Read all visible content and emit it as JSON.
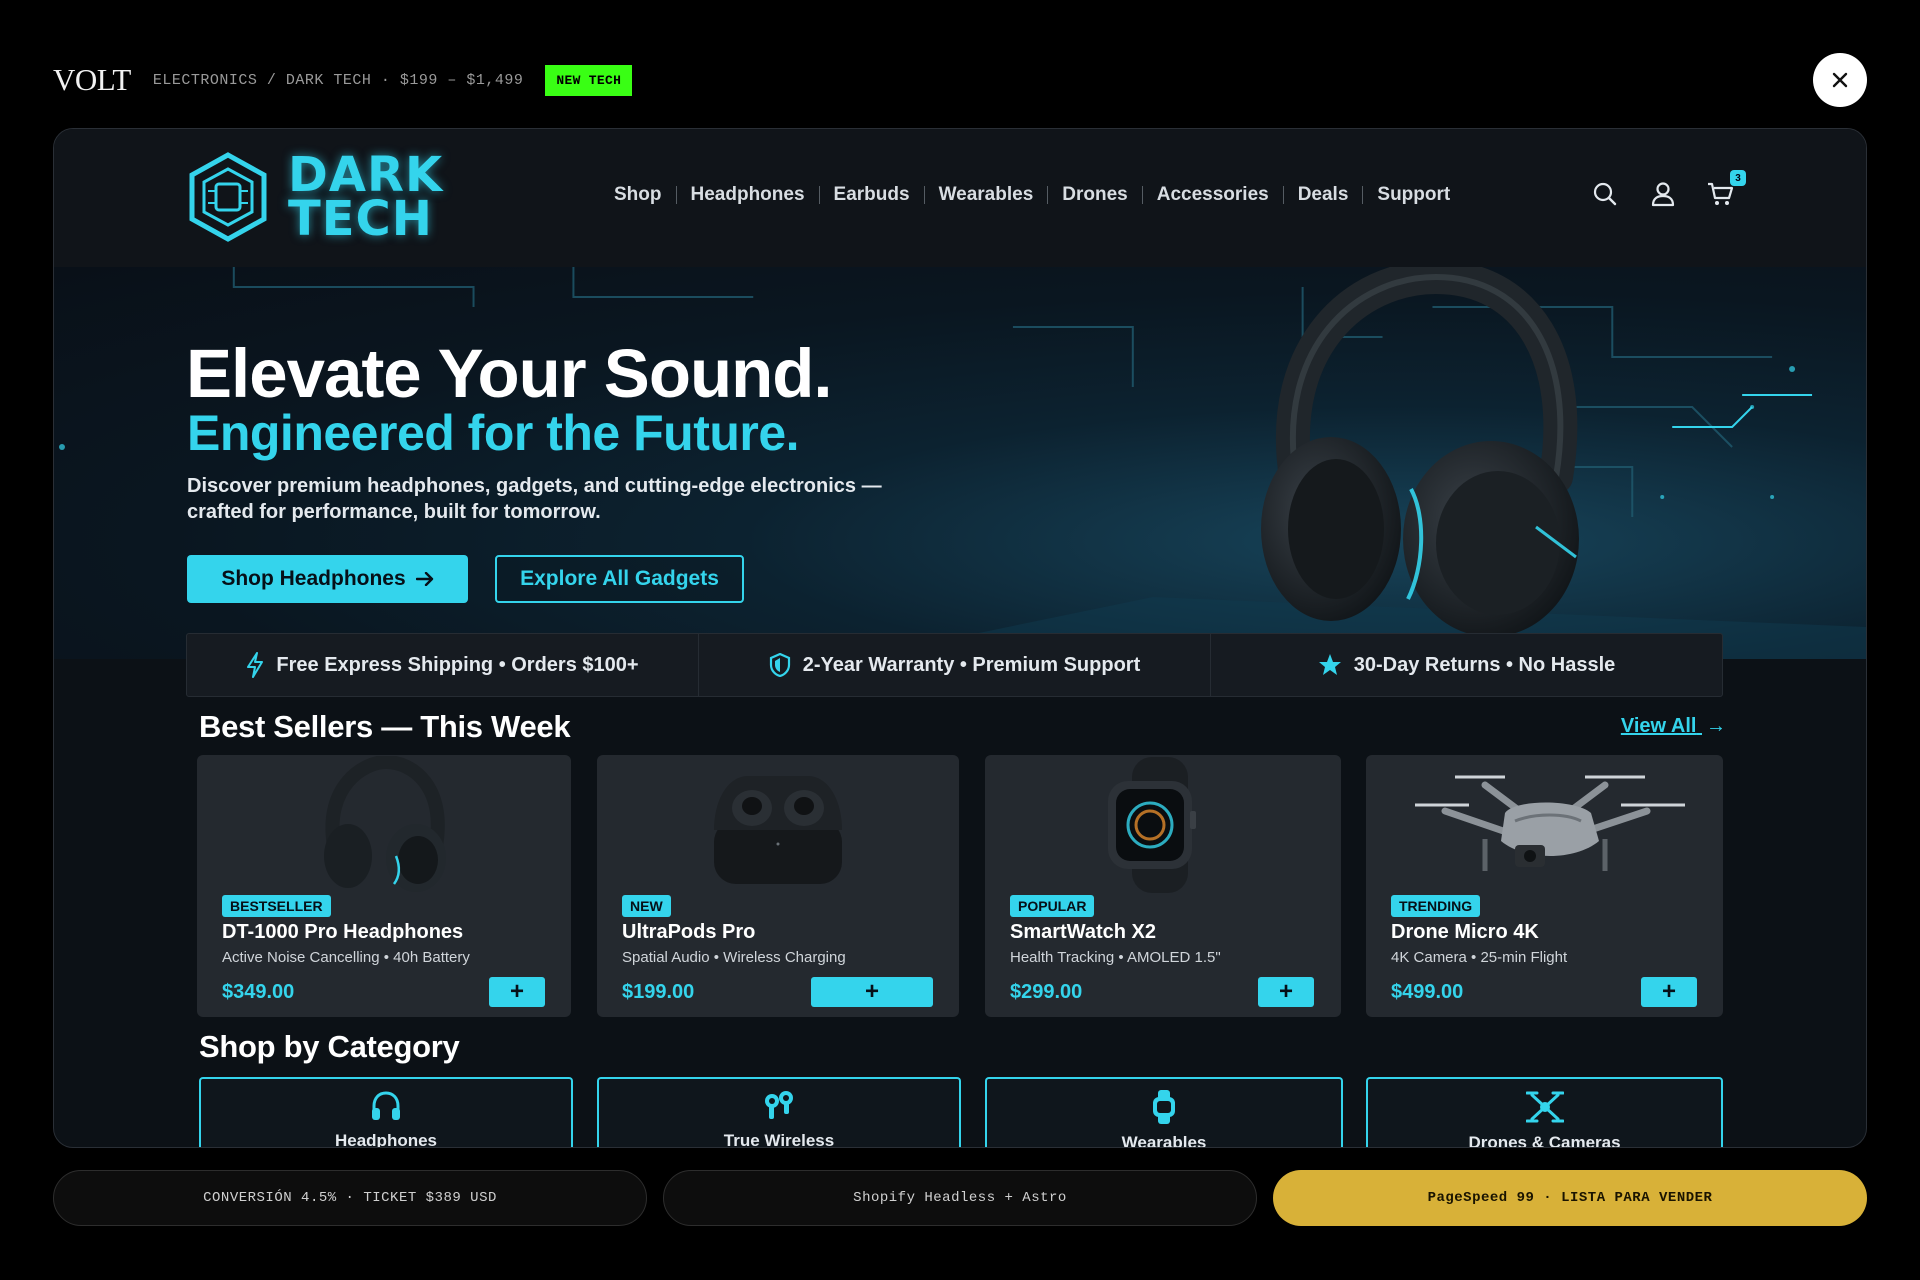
{
  "top": {
    "brand": "VOLT",
    "breadcrumb": "ELECTRONICS / DARK TECH · $199 – $1,499",
    "tag": "NEW TECH"
  },
  "site": {
    "logo_line1": "DARK",
    "logo_line2": "TECH",
    "nav": [
      "Shop",
      "Headphones",
      "Earbuds",
      "Wearables",
      "Drones",
      "Accessories",
      "Deals",
      "Support"
    ],
    "cart_count": "3"
  },
  "hero": {
    "title": "Elevate Your Sound.",
    "subtitle": "Engineered for the Future.",
    "description": "Discover premium headphones, gadgets, and cutting-edge electronics — crafted for performance, built for tomorrow.",
    "primary_cta": "Shop Headphones",
    "secondary_cta": "Explore All Gadgets"
  },
  "benefits": [
    {
      "icon": "lightning-icon",
      "text": "Free Express Shipping • Orders $100+"
    },
    {
      "icon": "shield-icon",
      "text": "2-Year Warranty • Premium Support"
    },
    {
      "icon": "star-icon",
      "text": "30-Day Returns • No Hassle"
    }
  ],
  "best_sellers": {
    "title": "Best Sellers — This Week",
    "view_all": "View All",
    "products": [
      {
        "badge": "BESTSELLER",
        "name": "DT-1000 Pro Headphones",
        "desc": "Active Noise Cancelling • 40h Battery",
        "price": "$349.00",
        "add": "+"
      },
      {
        "badge": "NEW",
        "name": "UltraPods Pro",
        "desc": "Spatial Audio • Wireless Charging",
        "price": "$199.00",
        "add": "+"
      },
      {
        "badge": "POPULAR",
        "name": "SmartWatch X2",
        "desc": "Health Tracking • AMOLED 1.5\"",
        "price": "$299.00",
        "add": "+"
      },
      {
        "badge": "TRENDING",
        "name": "Drone Micro 4K",
        "desc": "4K Camera • 25-min Flight",
        "price": "$499.00",
        "add": "+"
      }
    ]
  },
  "categories": {
    "title": "Shop by Category",
    "items": [
      {
        "icon": "headphones-icon",
        "label": "Headphones"
      },
      {
        "icon": "earbuds-icon",
        "label": "True Wireless"
      },
      {
        "icon": "watch-icon",
        "label": "Wearables"
      },
      {
        "icon": "drone-icon",
        "label": "Drones & Cameras"
      }
    ]
  },
  "footer": {
    "stats": "CONVERSIÓN 4.5% · TICKET $389 USD",
    "stack": "Shopify Headless + Astro",
    "score": "PageSpeed 99 · LISTA PARA VENDER"
  },
  "colors": {
    "accent": "#34d4ec",
    "tag_green": "#39ff14",
    "gold": "#d8b138",
    "background": "#000000"
  }
}
